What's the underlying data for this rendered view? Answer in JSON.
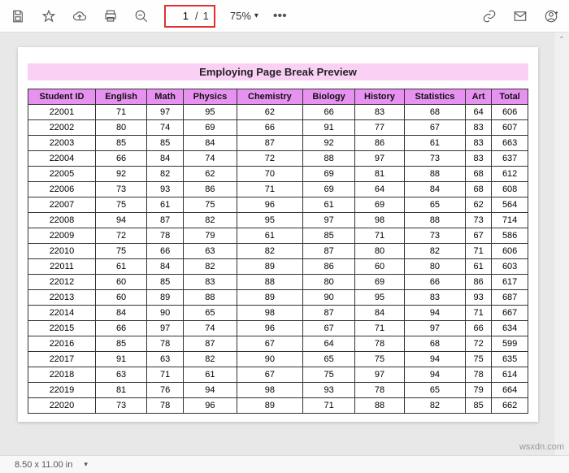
{
  "toolbar": {
    "page_current": "1",
    "page_sep": "/",
    "page_total": "1",
    "zoom_label": "75%",
    "ellipsis": "•••"
  },
  "document": {
    "title": "Employing Page Break Preview",
    "headers": [
      "Student ID",
      "English",
      "Math",
      "Physics",
      "Chemistry",
      "Biology",
      "History",
      "Statistics",
      "Art",
      "Total"
    ],
    "rows": [
      [
        "22001",
        "71",
        "97",
        "95",
        "62",
        "66",
        "83",
        "68",
        "64",
        "606"
      ],
      [
        "22002",
        "80",
        "74",
        "69",
        "66",
        "91",
        "77",
        "67",
        "83",
        "607"
      ],
      [
        "22003",
        "85",
        "85",
        "84",
        "87",
        "92",
        "86",
        "61",
        "83",
        "663"
      ],
      [
        "22004",
        "66",
        "84",
        "74",
        "72",
        "88",
        "97",
        "73",
        "83",
        "637"
      ],
      [
        "22005",
        "92",
        "82",
        "62",
        "70",
        "69",
        "81",
        "88",
        "68",
        "612"
      ],
      [
        "22006",
        "73",
        "93",
        "86",
        "71",
        "69",
        "64",
        "84",
        "68",
        "608"
      ],
      [
        "22007",
        "75",
        "61",
        "75",
        "96",
        "61",
        "69",
        "65",
        "62",
        "564"
      ],
      [
        "22008",
        "94",
        "87",
        "82",
        "95",
        "97",
        "98",
        "88",
        "73",
        "714"
      ],
      [
        "22009",
        "72",
        "78",
        "79",
        "61",
        "85",
        "71",
        "73",
        "67",
        "586"
      ],
      [
        "22010",
        "75",
        "66",
        "63",
        "82",
        "87",
        "80",
        "82",
        "71",
        "606"
      ],
      [
        "22011",
        "61",
        "84",
        "82",
        "89",
        "86",
        "60",
        "80",
        "61",
        "603"
      ],
      [
        "22012",
        "60",
        "85",
        "83",
        "88",
        "80",
        "69",
        "66",
        "86",
        "617"
      ],
      [
        "22013",
        "60",
        "89",
        "88",
        "89",
        "90",
        "95",
        "83",
        "93",
        "687"
      ],
      [
        "22014",
        "84",
        "90",
        "65",
        "98",
        "87",
        "84",
        "94",
        "71",
        "667"
      ],
      [
        "22015",
        "66",
        "97",
        "74",
        "96",
        "67",
        "71",
        "97",
        "66",
        "634"
      ],
      [
        "22016",
        "85",
        "78",
        "87",
        "67",
        "64",
        "78",
        "68",
        "72",
        "599"
      ],
      [
        "22017",
        "91",
        "63",
        "82",
        "90",
        "65",
        "75",
        "94",
        "75",
        "635"
      ],
      [
        "22018",
        "63",
        "71",
        "61",
        "67",
        "75",
        "97",
        "94",
        "78",
        "614"
      ],
      [
        "22019",
        "81",
        "76",
        "94",
        "98",
        "93",
        "78",
        "65",
        "79",
        "664"
      ],
      [
        "22020",
        "73",
        "78",
        "96",
        "89",
        "71",
        "88",
        "82",
        "85",
        "662"
      ]
    ]
  },
  "status": {
    "page_size": "8.50 x 11.00 in"
  },
  "watermark": "wsxdn.com"
}
